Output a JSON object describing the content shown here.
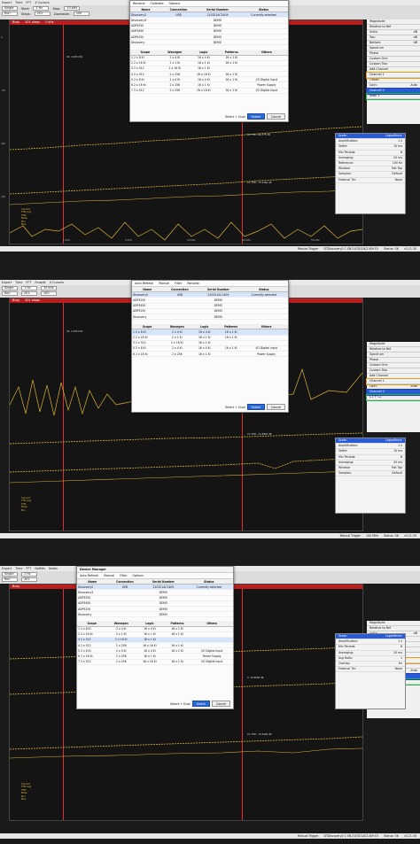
{
  "screens": [
    {
      "menu": [
        "Export",
        "Time",
        "FFT",
        "Fmsplit",
        "Nofilds",
        "X Cursors",
        "Notes"
      ],
      "controls": {
        "mode": "Single",
        "start_label": "Start:",
        "start": "1 Hz",
        "stop_label": "Stop:",
        "stop": "10 kHz",
        "steps_label": "Steps:",
        "steps": "201",
        "zoom_label": "Zoomable:",
        "zoom": "100",
        "source_label": "Source:",
        "run": "Run"
      },
      "status": [
        "Busy",
        "201 steps",
        "1 kHz",
        "100 kHz"
      ],
      "dialog": {
        "title": "Device Manager",
        "tabs": [
          "Auto Refresh",
          "Manual",
          "Filter",
          "Rename",
          "Calibrate",
          "Options"
        ],
        "devices": {
          "headers": [
            "Name",
            "Connection",
            "Serial Number",
            "Status"
          ],
          "rows": [
            [
              "Discovery2",
              "USB",
              "210321AC1409",
              "Currently selected"
            ],
            [
              "Discovery3",
              "",
              "DEMO",
              ""
            ],
            [
              "ADP3250",
              "",
              "DEMO",
              ""
            ],
            [
              "ADP3450",
              "",
              "DEMO",
              ""
            ],
            [
              "ADP5250",
              "",
              "DEMO",
              ""
            ],
            [
              "Discovery",
              "",
              "DEMO",
              ""
            ]
          ]
        },
        "configs": {
          "headers": [
            "Scope",
            "Wavegen",
            "Logic",
            "Patterns",
            "Others"
          ],
          "rows": [
            [
              "1  2 x 8 Ki",
              "2 x 4 Ki",
              "16 x 4 Ki",
              "16 x 1 Ki",
              ""
            ],
            [
              "2  2 x 16 Ki",
              "2 x 1 Ki",
              "16 x 1 Ki",
              "16 x 1 Ki",
              ""
            ],
            [
              "3  2 x 512",
              "2 x 16 Ki",
              "16 x 1 Ki",
              "",
              ""
            ],
            [
              "4  2 x 512",
              "2 x 256",
              "16 x 16 Ki",
              "16 x 1 Ki",
              ""
            ],
            [
              "5  2 x 8 Ki",
              "2 x 4 Ki",
              "16 x 4 Ki",
              "16 x 1 Ki",
              "I/O Digital Input"
            ],
            [
              "6  2 x 16 Ki",
              "2 x 256",
              "16 x 1 Ki",
              "",
              "Power Supply"
            ],
            [
              "7  2 x 512",
              "2 x 256",
              "16 x 16 Ki",
              "16 x 1 Ki",
              "I/O Digital Input"
            ]
          ]
        },
        "btns": [
          "Select + Dual",
          "Select",
          "Cancel"
        ]
      },
      "side": [
        "Magnitude",
        "Relative to Ref",
        "Units:",
        "dB",
        "Top:",
        "dB",
        "Bottom:",
        "dB",
        "Spectrum",
        "Phase",
        "Custom One",
        "Custom Two",
        "Add Channel",
        "Channel 1",
        "Offset:",
        "Gain:",
        "Auto",
        "Channel 2",
        "Math 1",
        "C1 + C2"
      ],
      "spectrum": {
        "title": "Options",
        "scale_label": "Scale:",
        "scale": "Logarithmic",
        "rows": [
          [
            "Amplification:",
            "1 x"
          ],
          [
            "Settle:",
            "10 ms"
          ],
          [
            "Min Periods:",
            "8"
          ],
          [
            "Averaging:",
            "20 ms"
          ],
          [
            "Avg Ratio:",
            "1"
          ],
          [
            "Reference:",
            "100 Hz"
          ],
          [
            "Overlap",
            "Hz"
          ],
          [
            "Window:",
            "Flat Top"
          ],
          [
            "Samples:",
            "Default"
          ],
          [
            "External Trn:",
            "None"
          ]
        ]
      },
      "yticks": [
        "0",
        "-10",
        "-20",
        "-30",
        "-40",
        "-50",
        "-60",
        "-70",
        "-80",
        "-90",
        "-100"
      ],
      "xticks": [
        "1 kHz",
        "2 kHz",
        "3 kHz",
        "4 kHz",
        "5 kHz",
        "10 kHz",
        "20 kHz",
        "30 kHz",
        "50 kHz"
      ],
      "legend": [
        "Current",
        "THD avg",
        "THD",
        "Mean",
        "Min",
        "Max"
      ],
      "annotations": [
        "X2: 2.045 kHz",
        "C1 THD: -60.375 dB",
        "C1 THD: -75.5484 dB",
        "C1 THD: -71.8862 dB",
        "X: 19.9958 dB"
      ],
      "bottom_status": [
        "Manual Trigger",
        "DTDiscovery2 C SN:210321AC1409 E3",
        "100 MHz",
        "Status: OK",
        "v3.21.30"
      ]
    }
  ],
  "labels": {
    "screen2_caption": "Device Manager",
    "screen3_caption": "Device Manager"
  }
}
